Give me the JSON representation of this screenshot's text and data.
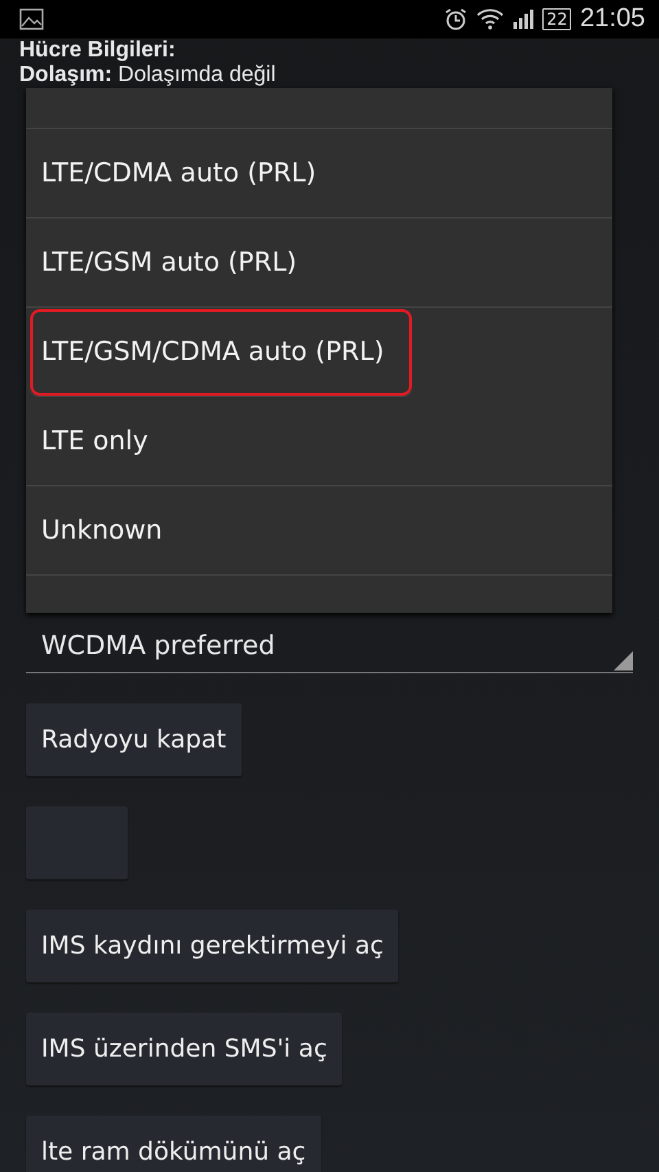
{
  "status_bar": {
    "battery": "22",
    "time": "21:05"
  },
  "info": {
    "title": "Hücre Bilgileri:",
    "roaming_label": "Dolaşım:",
    "roaming_value": "Dolaşımda değil"
  },
  "dropdown_menu": {
    "items": [
      {
        "label": "LTE/CDMA auto (PRL)",
        "selected": false
      },
      {
        "label": "LTE/GSM auto (PRL)",
        "selected": false
      },
      {
        "label": "LTE/GSM/CDMA auto (PRL)",
        "selected": true
      },
      {
        "label": "LTE only",
        "selected": false
      },
      {
        "label": "Unknown",
        "selected": false
      }
    ]
  },
  "network_type_spinner": {
    "value": "WCDMA preferred"
  },
  "buttons": [
    {
      "kind": "text",
      "label": "Radyoyu kapat"
    },
    {
      "kind": "blank"
    },
    {
      "kind": "text",
      "label": "IMS kaydını gerektirmeyi aç"
    },
    {
      "kind": "text",
      "label": "IMS üzerinden SMS'i aç"
    },
    {
      "kind": "text",
      "label": "lte ram dökümünü aç"
    }
  ]
}
